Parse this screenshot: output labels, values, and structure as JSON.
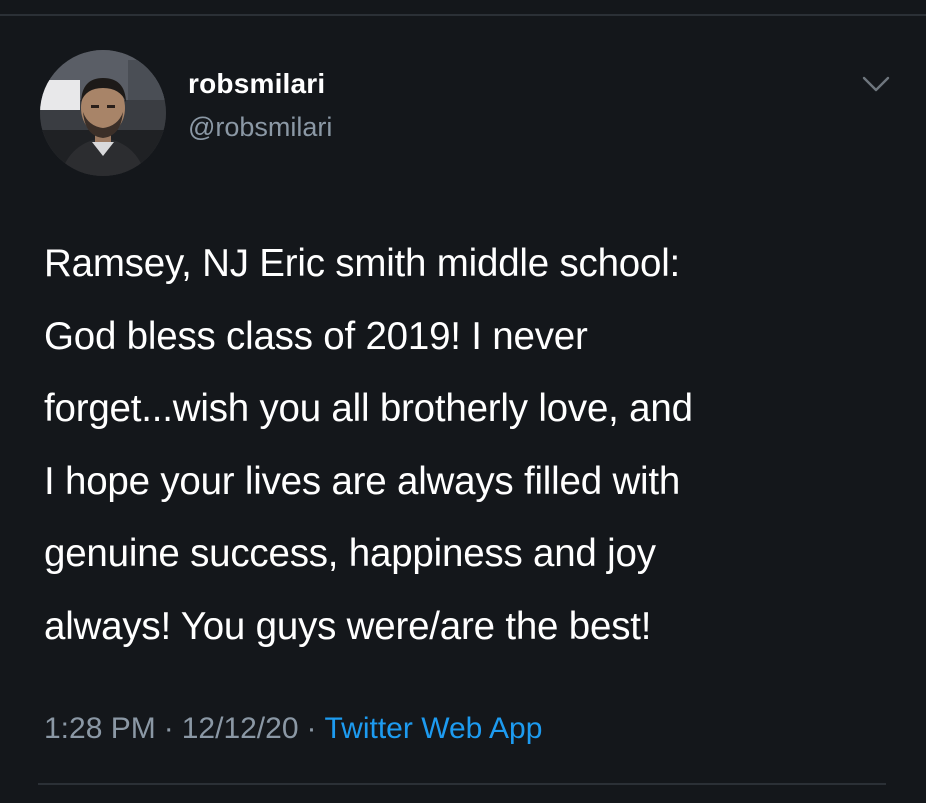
{
  "tweet": {
    "author": {
      "display_name": "robsmilari",
      "handle": "@robsmilari"
    },
    "text": "Ramsey, NJ Eric smith middle school:\nGod bless class of 2019!  I never\nforget...wish you all brotherly love, and\nI hope your lives are always filled with\ngenuine success, happiness and joy\nalways!  You guys were/are the best!",
    "time": "1:28 PM",
    "date": "12/12/20",
    "separator": "·",
    "source": "Twitter Web App"
  },
  "icons": {
    "menu": "chevron-down-icon",
    "avatar": "profile-photo"
  },
  "colors": {
    "background": "#14171b",
    "text_primary": "#ffffff",
    "text_secondary": "#8b98a5",
    "link": "#1d9bf0",
    "divider": "#2b3036"
  }
}
